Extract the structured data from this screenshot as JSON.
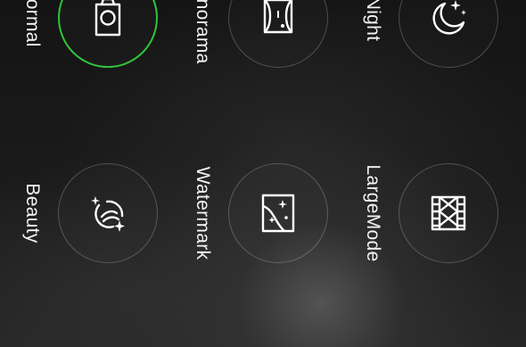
{
  "camera_modes": {
    "items": [
      {
        "label": "Normal",
        "icon": "camera-icon",
        "selected": true
      },
      {
        "label": "Panorama",
        "icon": "hourglass-icon",
        "selected": false
      },
      {
        "label": "Night",
        "icon": "moon-stars-icon",
        "selected": false
      },
      {
        "label": "Beauty",
        "icon": "sparkle-ring-icon",
        "selected": false
      },
      {
        "label": "Watermark",
        "icon": "picture-sparkle-icon",
        "selected": false
      },
      {
        "label": "LargeMode",
        "icon": "film-strip-icon",
        "selected": false
      }
    ],
    "colors": {
      "selected_ring": "#2fc43a",
      "ring": "#5a5a5a",
      "label": "#f4f4f4"
    }
  }
}
